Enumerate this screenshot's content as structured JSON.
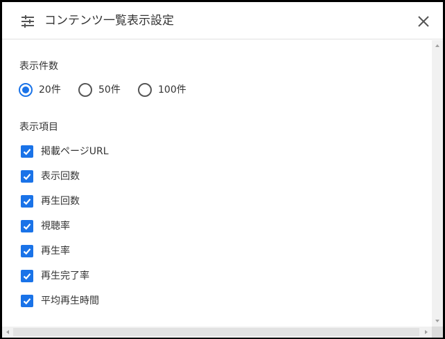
{
  "dialog": {
    "title": "コンテンツ一覧表示設定",
    "title_icon": "tune-icon",
    "close_icon": "close-icon"
  },
  "display_count": {
    "label": "表示件数",
    "options": [
      {
        "label": "20件",
        "selected": true
      },
      {
        "label": "50件",
        "selected": false
      },
      {
        "label": "100件",
        "selected": false
      }
    ]
  },
  "display_items": {
    "label": "表示項目",
    "items": [
      {
        "label": "掲載ページURL",
        "checked": true
      },
      {
        "label": "表示回数",
        "checked": true
      },
      {
        "label": "再生回数",
        "checked": true
      },
      {
        "label": "視聴率",
        "checked": true
      },
      {
        "label": "再生率",
        "checked": true
      },
      {
        "label": "再生完了率",
        "checked": true
      },
      {
        "label": "平均再生時間",
        "checked": true
      }
    ]
  },
  "colors": {
    "accent": "#1a73e8",
    "text": "#333333",
    "divider": "#e0e0e0"
  }
}
